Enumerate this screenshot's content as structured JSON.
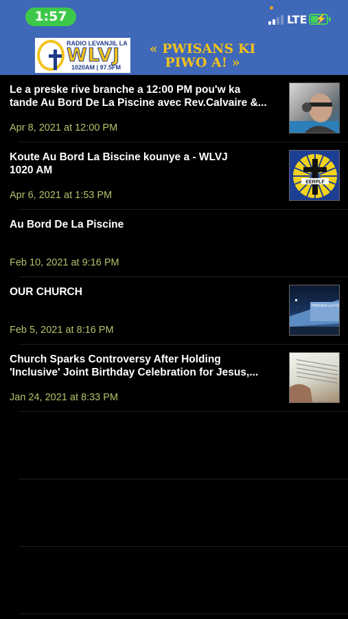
{
  "status": {
    "time": "1:57",
    "network": "LTE"
  },
  "brand": {
    "top_text": "RADIO LEVANJIL LA",
    "call_sign": "WLVJ",
    "frequencies": "1020AM | 97.5FM",
    "slogan": "« PWISANS KI PIWO A! »"
  },
  "colors": {
    "header_bg": "#3f68b9",
    "date_text": "#b4c36a",
    "accent_yellow": "#f2c21a"
  },
  "feed": [
    {
      "title": "Le a preske rive branche a 12:00 PM  pou'w ka\ntande Au Bord De La Piscine avec Rev.Calvaire &...",
      "date": "Apr 8, 2021 at 12:00 PM",
      "thumbnail": "host-photo"
    },
    {
      "title": "Koute Au Bord La Biscine kounye a - WLVJ\n1020 AM",
      "date": "Apr 6, 2021 at 1:53 PM",
      "thumbnail": "eerplf-logo",
      "thumb_text": "EERPLF"
    },
    {
      "title": "Au Bord De La Piscine",
      "date": "Feb 10, 2021 at 9:16 PM",
      "thumbnail": ""
    },
    {
      "title": "OUR CHURCH",
      "date": "Feb 5, 2021 at 8:16 PM",
      "thumbnail": "church-night-photo",
      "thumb_text": "PWISANS LA FOI"
    },
    {
      "title": "Church Sparks Controversy After Holding\n'Inclusive' Joint Birthday Celebration for Jesus,...",
      "date": "Jan 24, 2021 at 8:33 PM",
      "thumbnail": "bible-photo"
    }
  ]
}
